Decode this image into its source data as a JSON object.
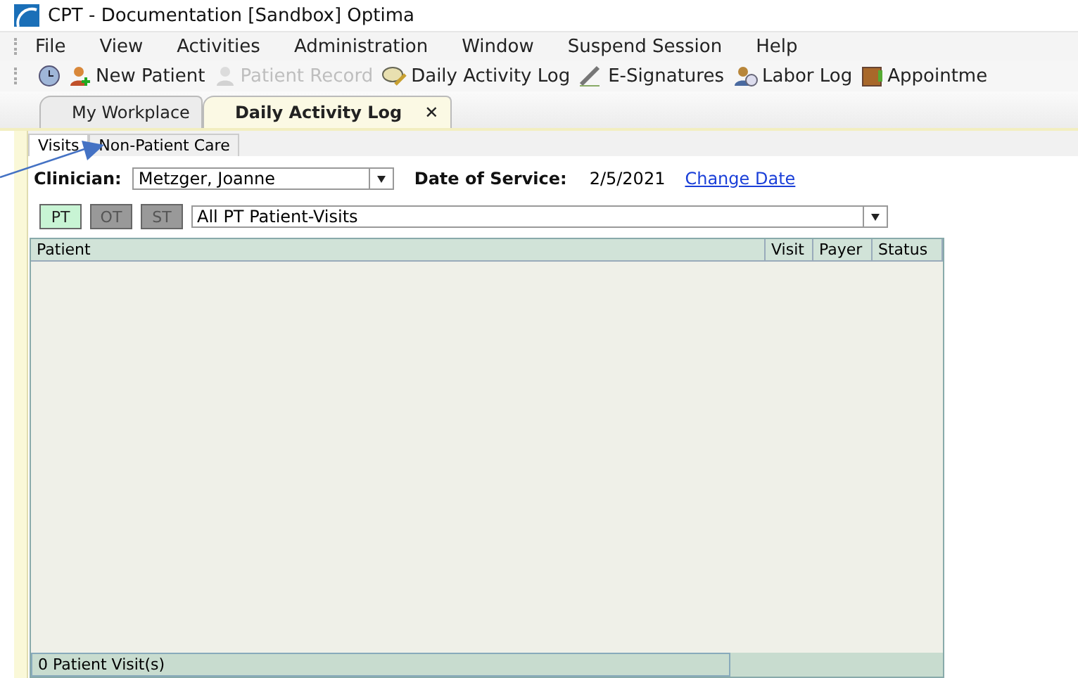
{
  "window": {
    "title": "CPT -  Documentation [Sandbox] Optima"
  },
  "menu": [
    "File",
    "View",
    "Activities",
    "Administration",
    "Window",
    "Suspend Session",
    "Help"
  ],
  "toolbar": [
    {
      "kind": "clock",
      "disabled": false
    },
    {
      "label": "New Patient",
      "kind": "person-add",
      "disabled": false
    },
    {
      "label": "Patient Record",
      "kind": "person",
      "disabled": true
    },
    {
      "label": "Daily Activity Log",
      "kind": "log",
      "disabled": false
    },
    {
      "label": "E-Signatures",
      "kind": "pen",
      "disabled": false
    },
    {
      "label": "Labor Log",
      "kind": "person-clock",
      "disabled": false
    },
    {
      "label": "Appointme",
      "kind": "book",
      "disabled": false
    }
  ],
  "tabs": [
    {
      "label": "My Workplace",
      "selected": false
    },
    {
      "label": "Daily Activity Log",
      "selected": true,
      "close": "✕"
    }
  ],
  "subtabs": [
    {
      "label": "Visits",
      "selected": true
    },
    {
      "label": "Non-Patient Care",
      "selected": false
    }
  ],
  "clinician": {
    "label": "Clinician:",
    "value": "Metzger, Joanne"
  },
  "date": {
    "label": "Date of Service:",
    "value": "2/5/2021",
    "link": "Change Date"
  },
  "disciplines": [
    {
      "label": "PT",
      "selected": true
    },
    {
      "label": "OT",
      "selected": false
    },
    {
      "label": "ST",
      "selected": false
    }
  ],
  "filter": {
    "value": "All PT Patient-Visits"
  },
  "table": {
    "columns": [
      "Patient",
      "Visit",
      "Payer",
      "Status"
    ],
    "footer": "0 Patient Visit(s)"
  }
}
